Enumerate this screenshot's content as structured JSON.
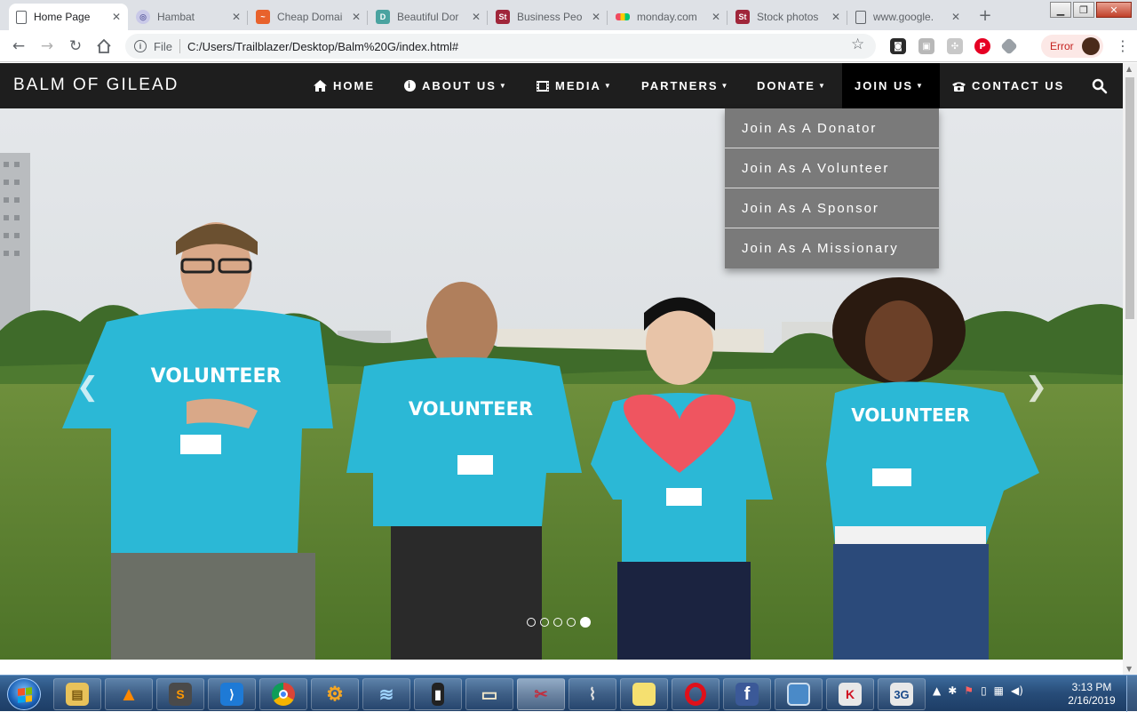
{
  "browser": {
    "tabs": [
      {
        "title": "Home Page",
        "icon": "page-icon",
        "active": true
      },
      {
        "title": "Hambat",
        "icon": "globe-icon",
        "active": false
      },
      {
        "title": "Cheap Domai",
        "icon": "namecheap-icon",
        "active": false
      },
      {
        "title": "Beautiful Dor",
        "icon": "d-letter-icon",
        "active": false
      },
      {
        "title": "Business Peo",
        "icon": "stock-st-icon",
        "active": false
      },
      {
        "title": "monday.com",
        "icon": "monday-icon",
        "active": false
      },
      {
        "title": "Stock photos",
        "icon": "stock-st-icon",
        "active": false
      },
      {
        "title": "www.google.",
        "icon": "page-icon",
        "active": false
      }
    ],
    "address": {
      "prefix": "File",
      "url": "C:/Users/Trailblazer/Desktop/Balm%20G/index.html#"
    },
    "error_label": "Error"
  },
  "site": {
    "brand": "BALM OF GILEAD",
    "nav": [
      {
        "label": "HOME",
        "icon": "home-icon",
        "caret": false
      },
      {
        "label": "ABOUT US",
        "icon": "info-icon",
        "caret": true
      },
      {
        "label": "MEDIA",
        "icon": "film-icon",
        "caret": true
      },
      {
        "label": "PARTNERS",
        "icon": "",
        "caret": true
      },
      {
        "label": "DONATE",
        "icon": "",
        "caret": true
      },
      {
        "label": "JOIN US",
        "icon": "",
        "caret": true,
        "open": true
      },
      {
        "label": "CONTACT US",
        "icon": "phone-icon",
        "caret": false
      }
    ],
    "dropdown": [
      "Join As A Donator",
      "Join As A Volunteer",
      "Join As A Sponsor",
      "Join As A Missionary"
    ],
    "carousel": {
      "slide_count": 5,
      "active_index": 4,
      "shirt_text": "VOLUNTEER"
    }
  },
  "taskbar": {
    "apps": [
      "file-explorer-icon",
      "vlc-icon",
      "sublime-icon",
      "vscode-icon",
      "chrome-icon",
      "settings-gear-icon",
      "wings-icon",
      "usb-drive-icon",
      "book-icon",
      "snipping-tool-icon",
      "microphone-icon",
      "sticky-notes-icon",
      "opera-icon",
      "facebook-icon",
      "display-icon",
      "kaspersky-icon",
      "network-3g-icon"
    ],
    "clock": {
      "time": "3:13 PM",
      "date": "2/16/2019"
    }
  },
  "colors": {
    "nav_bg": "#1e1e1e",
    "nav_open": "#000000",
    "dropdown_bg": "#7a7a7a",
    "shirt": "#2bb8d6",
    "heart": "#ef5560"
  }
}
